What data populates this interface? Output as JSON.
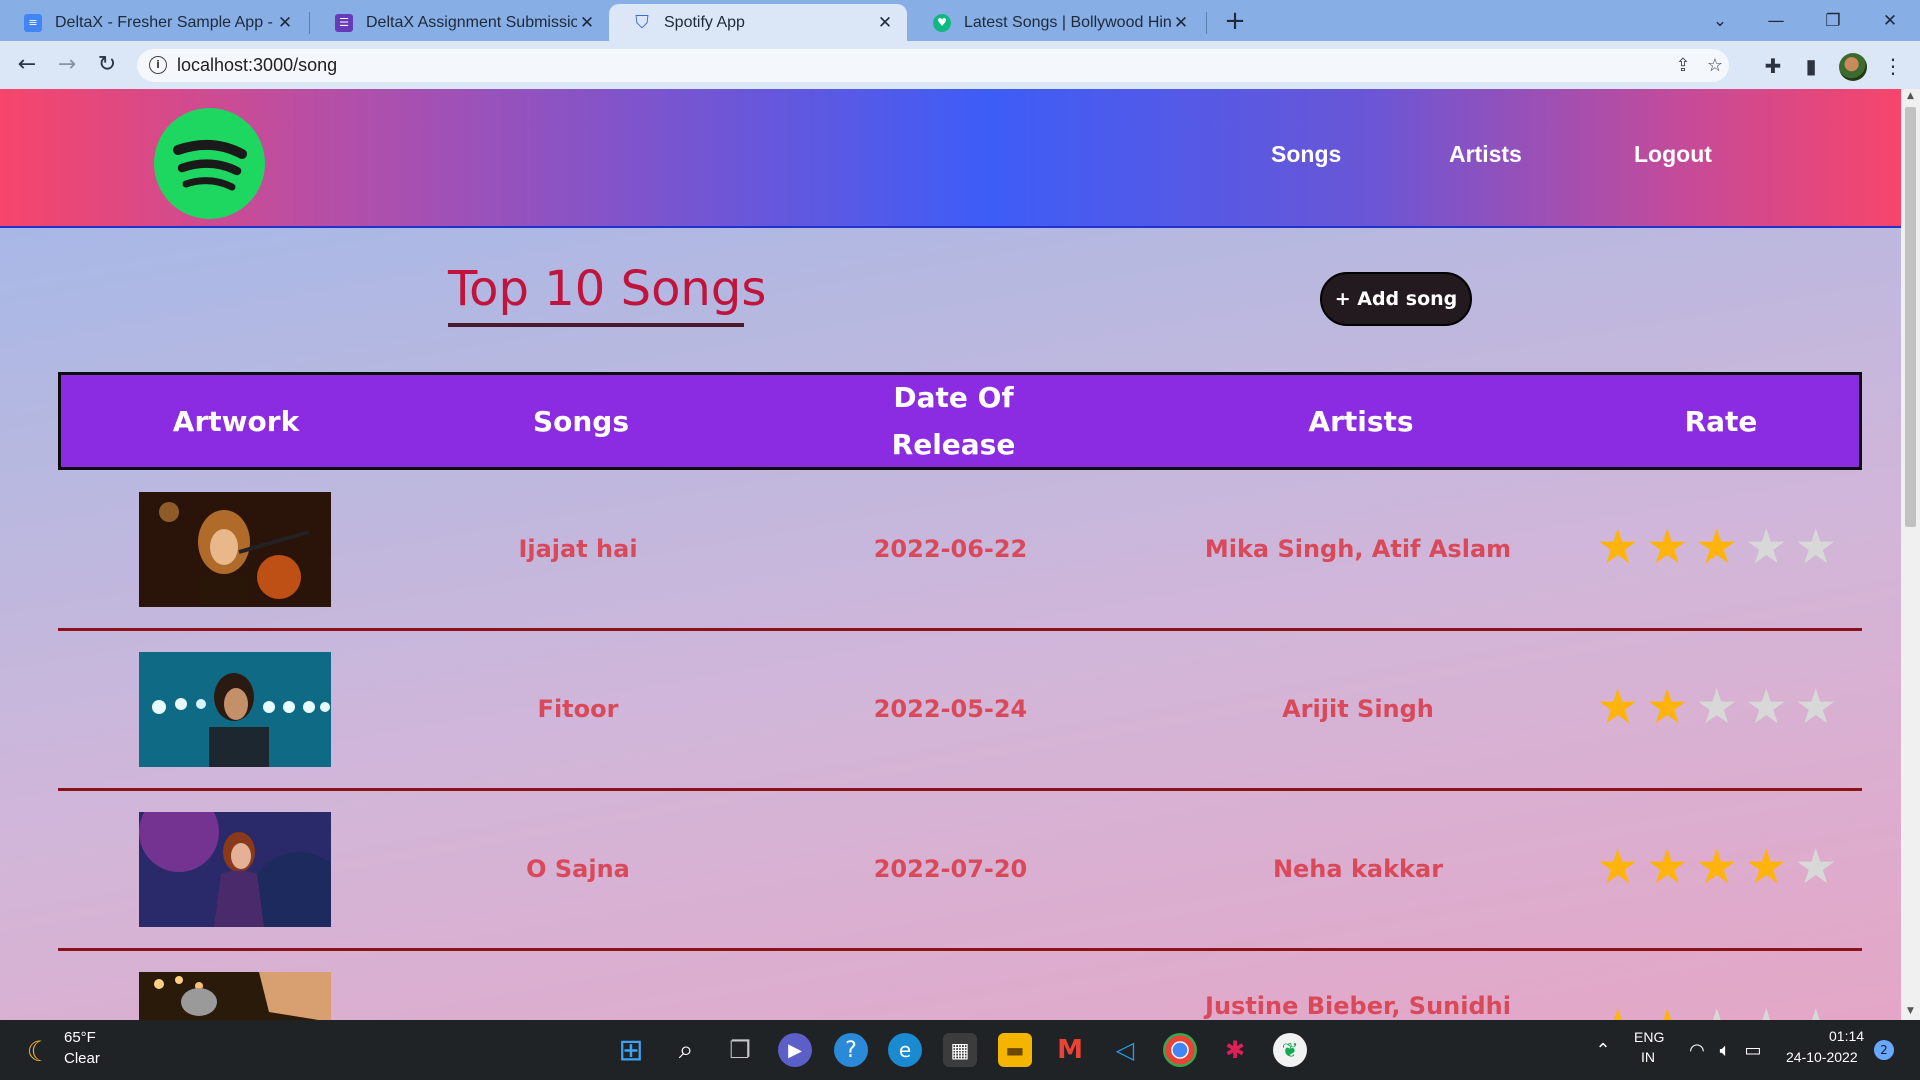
{
  "browser": {
    "tabs": [
      {
        "title": "DeltaX - Fresher Sample App - Sp",
        "icon": "docs-icon",
        "color": "#4285f4"
      },
      {
        "title": "DeltaX Assignment Submission -",
        "icon": "forms-icon",
        "color": "#673ab7"
      },
      {
        "title": "Spotify App",
        "icon": "react-shield-icon",
        "color": "#3b6bd6"
      },
      {
        "title": "Latest Songs | Bollywood Hindi T",
        "icon": "song-app-icon",
        "color": "#10b981"
      }
    ],
    "url": "localhost:3000/song"
  },
  "header": {
    "nav": [
      "Songs",
      "Artists",
      "Logout"
    ]
  },
  "page": {
    "title": "Top 10 Songs",
    "add_button": "+ Add song"
  },
  "table": {
    "columns": [
      "Artwork",
      "Songs",
      "Date Of Release",
      "Artists",
      "Rate"
    ],
    "rows": [
      {
        "song": "Ijajat hai",
        "date": "2022-06-22",
        "artists": "Mika Singh, Atif Aslam",
        "rating": 3
      },
      {
        "song": "Fitoor",
        "date": "2022-05-24",
        "artists": "Arijit Singh",
        "rating": 2
      },
      {
        "song": "O Sajna",
        "date": "2022-07-20",
        "artists": "Neha kakkar",
        "rating": 4
      },
      {
        "song": "",
        "date": "",
        "artists": "Justine Bieber, Sunidhi",
        "rating": 2
      }
    ],
    "max_rating": 5
  },
  "taskbar": {
    "weather_temp": "65°F",
    "weather_text": "Clear",
    "lang_top": "ENG",
    "lang_bottom": "IN",
    "time": "01:14",
    "date": "24-10-2022",
    "notifications": "2"
  },
  "colors": {
    "accent_purple": "#8b2be2",
    "song_text": "#d9495a",
    "title": "#c0143c",
    "spotify_green": "#1ed760",
    "star_on": "#ffb30d",
    "star_off": "#d8d8d8"
  }
}
